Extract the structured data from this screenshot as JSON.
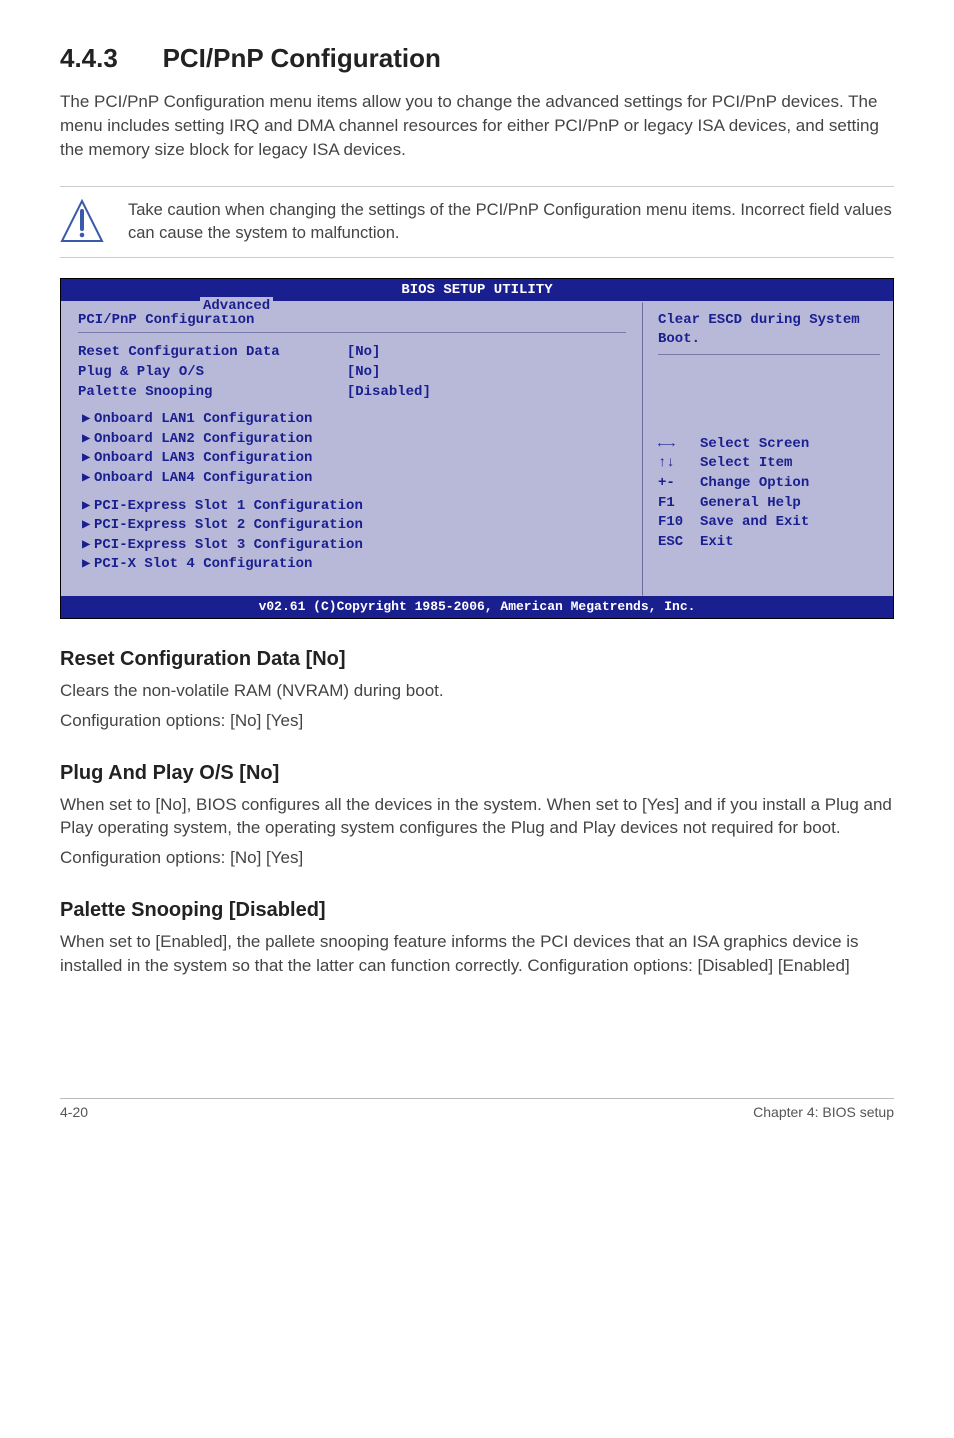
{
  "header": {
    "section_no": "4.4.3",
    "title": "PCI/PnP Configuration"
  },
  "intro": "The PCI/PnP Configuration menu items allow you to change the advanced settings for PCI/PnP devices. The menu includes setting IRQ and DMA channel resources for either PCI/PnP or legacy ISA devices, and setting the memory size block for legacy ISA devices.",
  "note": "Take caution when changing the settings of the PCI/PnP Configuration menu items. Incorrect field values can cause the system to malfunction.",
  "bios": {
    "top_title": "BIOS SETUP UTILITY",
    "tab": "Advanced",
    "left_title": "PCI/PnP Configuration",
    "rows": {
      "r1": "Reset Configuration Data        [No]",
      "r2": "Plug & Play O/S                 [No]",
      "r3": "Palette Snooping                [Disabled]"
    },
    "subs": {
      "s1": "Onboard LAN1 Configuration",
      "s2": "Onboard LAN2 Configuration",
      "s3": "Onboard LAN3 Configuration",
      "s4": "Onboard LAN4 Configuration",
      "s5": "PCI-Express Slot 1 Configuration",
      "s6": "PCI-Express Slot 2 Configuration",
      "s7": "PCI-Express Slot 3 Configuration",
      "s8": "PCI-X Slot 4 Configuration"
    },
    "help_top": "Clear ESCD during System Boot.",
    "keys": {
      "k1": "←→   Select Screen",
      "k2": "↑↓   Select Item",
      "k3": "+-   Change Option",
      "k4": "F1   General Help",
      "k5": "F10  Save and Exit",
      "k6": "ESC  Exit"
    },
    "footer": "v02.61 (C)Copyright 1985-2006, American Megatrends, Inc."
  },
  "sections": {
    "s1": {
      "title": "Reset Configuration Data [No]",
      "p1": "Clears the non-volatile RAM (NVRAM) during boot.",
      "p2": "Configuration options: [No] [Yes]"
    },
    "s2": {
      "title": "Plug And Play O/S [No]",
      "p1": "When set to [No], BIOS configures all the devices in the system. When set to [Yes] and if you install a Plug and Play operating system, the operating system configures the Plug and Play devices not required for boot.",
      "p2": "Configuration options: [No] [Yes]"
    },
    "s3": {
      "title": "Palette Snooping [Disabled]",
      "p1": "When set to [Enabled], the pallete snooping feature informs the PCI devices that an ISA graphics device is installed in the system so that the latter can function correctly. Configuration options: [Disabled] [Enabled]"
    }
  },
  "footer": {
    "left": "4-20",
    "right": "Chapter 4: BIOS setup"
  }
}
